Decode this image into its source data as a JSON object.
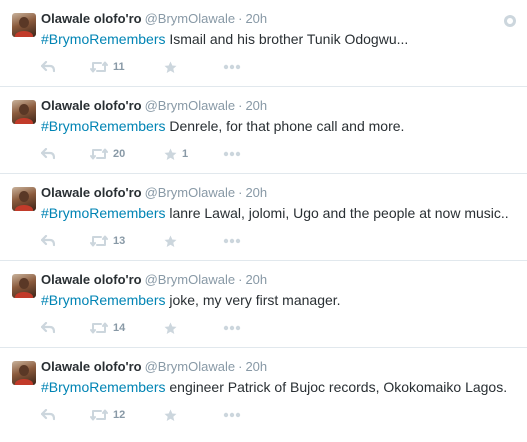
{
  "tweets": [
    {
      "fullname": "Olawale olofo'ro",
      "username": "@BrymOlawale",
      "separator": "·",
      "time": "20h",
      "hashtag": "#BrymoRemembers",
      "text": " Ismail and his brother Tunik Odogwu...",
      "retweets": "11",
      "favorites": ""
    },
    {
      "fullname": "Olawale olofo'ro",
      "username": "@BrymOlawale",
      "separator": "·",
      "time": "20h",
      "hashtag": "#BrymoRemembers",
      "text": " Denrele, for that phone call and more.",
      "retweets": "20",
      "favorites": "1"
    },
    {
      "fullname": "Olawale olofo'ro",
      "username": "@BrymOlawale",
      "separator": "·",
      "time": "20h",
      "hashtag": "#BrymoRemembers",
      "text": " lanre Lawal, jolomi, Ugo and the people at now music..",
      "retweets": "13",
      "favorites": ""
    },
    {
      "fullname": "Olawale olofo'ro",
      "username": "@BrymOlawale",
      "separator": "·",
      "time": "20h",
      "hashtag": "#BrymoRemembers",
      "text": " joke, my very first manager.",
      "retweets": "14",
      "favorites": ""
    },
    {
      "fullname": "Olawale olofo'ro",
      "username": "@BrymOlawale",
      "separator": "·",
      "time": "20h",
      "hashtag": "#BrymoRemembers",
      "text": " engineer Patrick of Bujoc records, Okokomaiko Lagos.",
      "retweets": "12",
      "favorites": ""
    }
  ],
  "colors": {
    "link": "#0084b4",
    "text": "#292f33",
    "muted": "#8899a6",
    "icon": "#ccd6dd",
    "divider": "#e1e8ed"
  },
  "icons": [
    "reply-icon",
    "retweet-icon",
    "favorite-icon",
    "more-icon",
    "pin-icon",
    "avatar"
  ]
}
